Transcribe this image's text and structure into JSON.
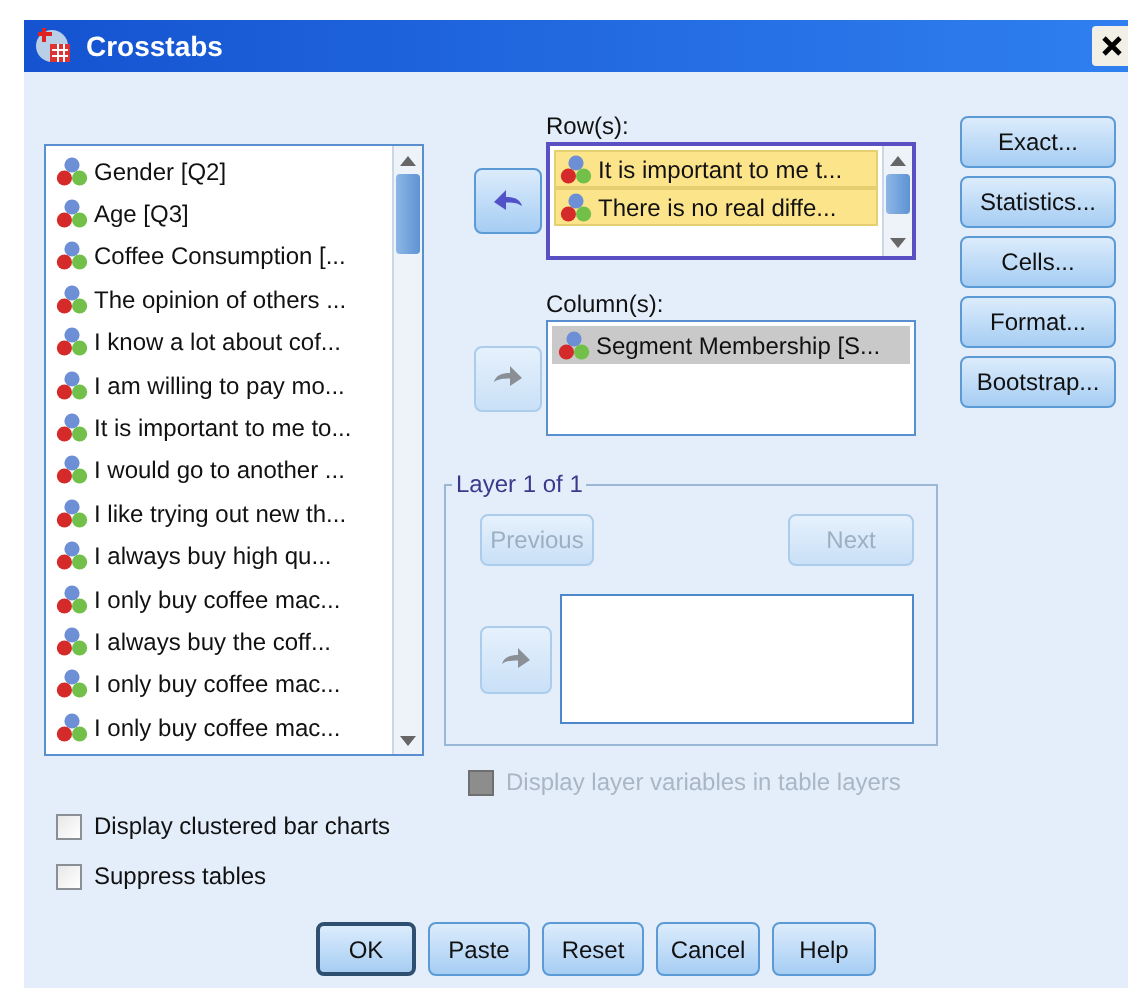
{
  "window": {
    "title": "Crosstabs"
  },
  "variables": {
    "items": [
      {
        "label": "Gender [Q2]",
        "selected": false
      },
      {
        "label": "Age [Q3]",
        "selected": false
      },
      {
        "label": "Coffee Consumption [...",
        "selected": false
      },
      {
        "label": "The opinion of others ...",
        "selected": false
      },
      {
        "label": "I know a lot about cof...",
        "selected": false
      },
      {
        "label": "I am willing to pay mo...",
        "selected": false
      },
      {
        "label": "It is important to me to...",
        "selected": false
      },
      {
        "label": "I would go to another ...",
        "selected": false
      },
      {
        "label": "I like trying out new th...",
        "selected": false
      },
      {
        "label": "I always buy high qu...",
        "selected": false
      },
      {
        "label": "I only buy coffee mac...",
        "selected": false
      },
      {
        "label": "I always buy the coff...",
        "selected": false
      },
      {
        "label": "I only buy coffee mac...",
        "selected": false
      },
      {
        "label": "I only buy coffee mac...",
        "selected": false
      }
    ]
  },
  "rows": {
    "label": "Row(s):",
    "focused": true,
    "move_button": {
      "kind": "left",
      "disabled": false
    },
    "items": [
      {
        "label": "It is important to me t...",
        "selected": true
      },
      {
        "label": "There is no real diffe...",
        "selected": true
      }
    ]
  },
  "columns": {
    "label": "Column(s):",
    "focused": false,
    "move_button": {
      "kind": "right",
      "disabled": true
    },
    "items": [
      {
        "label": "Segment Membership [S...",
        "selected": true
      }
    ]
  },
  "side_buttons": [
    "Exact...",
    "Statistics...",
    "Cells...",
    "Format...",
    "Bootstrap..."
  ],
  "layer": {
    "title": "Layer 1 of 1",
    "previous": {
      "label": "Previous",
      "disabled": true
    },
    "next": {
      "label": "Next",
      "disabled": true
    },
    "move_button": {
      "kind": "right",
      "disabled": true
    }
  },
  "options": [
    {
      "label": "Display layer variables in table layers",
      "checked": false,
      "disabled": true
    },
    {
      "label": "Display clustered bar charts",
      "checked": false,
      "disabled": false
    },
    {
      "label": "Suppress tables",
      "checked": false,
      "disabled": false
    }
  ],
  "buttons": [
    {
      "label": "OK",
      "default": true
    },
    {
      "label": "Paste",
      "default": false
    },
    {
      "label": "Reset",
      "default": false
    },
    {
      "label": "Cancel",
      "default": false
    },
    {
      "label": "Help",
      "default": false
    }
  ]
}
